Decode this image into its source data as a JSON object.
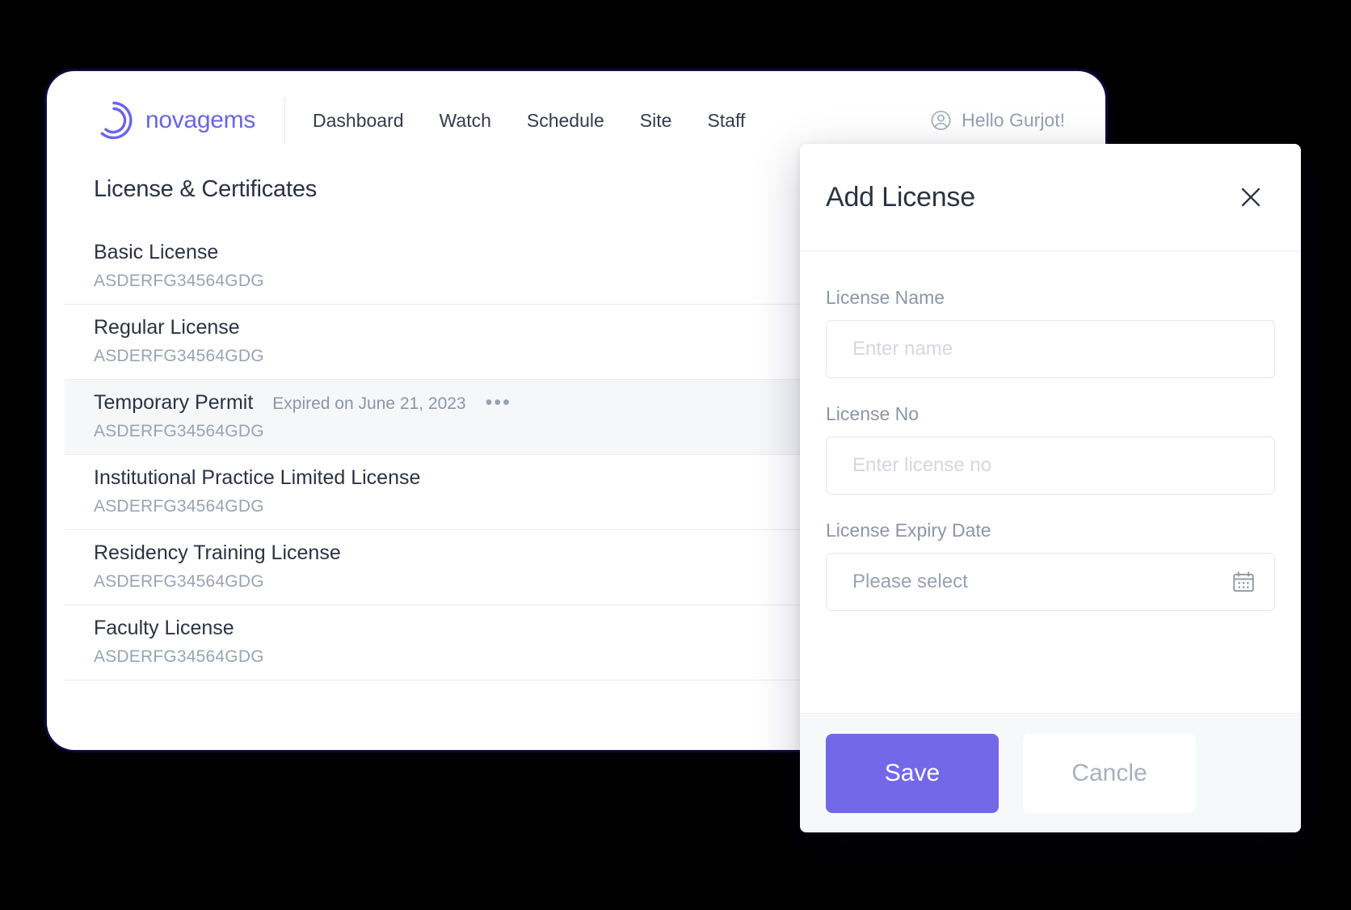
{
  "brand": {
    "name": "novagems",
    "logo_icon": "novagems-ring-logo",
    "accent_color": "#6c63e8"
  },
  "nav": {
    "links": [
      {
        "label": "Dashboard"
      },
      {
        "label": "Watch"
      },
      {
        "label": "Schedule"
      },
      {
        "label": "Site"
      },
      {
        "label": "Staff"
      }
    ],
    "user": {
      "greeting": "Hello Gurjot!",
      "avatar_icon": "user-circle-icon"
    }
  },
  "page": {
    "title": "License & Certificates"
  },
  "licenses": [
    {
      "name": "Basic License",
      "number": "ASDERFG34564GDG",
      "status": "",
      "active": false
    },
    {
      "name": "Regular License",
      "number": "ASDERFG34564GDG",
      "status": "",
      "active": false
    },
    {
      "name": "Temporary Permit",
      "number": "ASDERFG34564GDG",
      "status": "Expired on June 21, 2023",
      "active": true,
      "menu": "•••"
    },
    {
      "name": "Institutional Practice Limited License",
      "number": "ASDERFG34564GDG",
      "status": "",
      "active": false
    },
    {
      "name": "Residency Training License",
      "number": "ASDERFG34564GDG",
      "status": "",
      "active": false
    },
    {
      "name": "Faculty License",
      "number": "ASDERFG34564GDG",
      "status": "",
      "active": false
    }
  ],
  "modal": {
    "title": "Add License",
    "close_icon": "close-x-icon",
    "fields": {
      "license_name": {
        "label": "License Name",
        "placeholder": "Enter name",
        "value": ""
      },
      "license_no": {
        "label": "License No",
        "placeholder": "Enter license no",
        "value": ""
      },
      "expiry_date": {
        "label": "License Expiry Date",
        "placeholder": "Please select",
        "value": "",
        "icon": "calendar-icon"
      }
    },
    "save_label": "Save",
    "cancel_label": "Cancle",
    "save_color": "#7268e8"
  }
}
